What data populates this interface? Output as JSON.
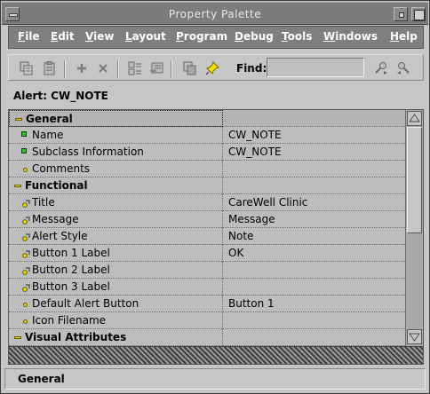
{
  "window": {
    "title": "Property Palette"
  },
  "menu": [
    {
      "label": "File",
      "u": "F",
      "rest": "ile"
    },
    {
      "label": "Edit",
      "u": "E",
      "rest": "dit"
    },
    {
      "label": "View",
      "u": "V",
      "rest": "iew"
    },
    {
      "label": "Layout",
      "u": "L",
      "rest": "ayout"
    },
    {
      "label": "Program",
      "u": "P",
      "rest": "rogram"
    },
    {
      "label": "Debug",
      "u": "D",
      "rest": "ebug"
    },
    {
      "label": "Tools",
      "u": "T",
      "rest": "ools"
    },
    {
      "label": "Windows",
      "u": "W",
      "rest": "indows"
    },
    {
      "label": "Help",
      "u": "H",
      "rest": "elp"
    }
  ],
  "toolbar": {
    "icons": [
      "copy-properties-icon",
      "paste-properties-icon",
      "add-property-icon",
      "delete-property-icon",
      "property-class-icon",
      "inherit-icon",
      "intersection-union-icon",
      "freeze-pin-icon",
      "find-forward-icon",
      "find-backward-icon"
    ],
    "find_label": "Find:",
    "find_value": ""
  },
  "alert": {
    "label": "Alert: CW_NOTE"
  },
  "properties": [
    {
      "type": "category",
      "name": "General",
      "value": "",
      "icon": "category-dash-icon"
    },
    {
      "type": "property",
      "name": "Name",
      "value": "CW_NOTE",
      "icon": "changed-property-icon"
    },
    {
      "type": "property",
      "name": "Subclass Information",
      "value": "CW_NOTE",
      "icon": "changed-property-icon"
    },
    {
      "type": "property",
      "name": "Comments",
      "value": "",
      "icon": "default-property-icon"
    },
    {
      "type": "category",
      "name": "Functional",
      "value": "",
      "icon": "category-dash-icon"
    },
    {
      "type": "property",
      "name": "Title",
      "value": "CareWell Clinic",
      "icon": "inherited-property-icon"
    },
    {
      "type": "property",
      "name": "Message",
      "value": "Message",
      "icon": "inherited-property-icon"
    },
    {
      "type": "property",
      "name": "Alert Style",
      "value": "Note",
      "icon": "inherited-property-icon"
    },
    {
      "type": "property",
      "name": "Button 1 Label",
      "value": "OK",
      "icon": "inherited-property-icon"
    },
    {
      "type": "property",
      "name": "Button 2 Label",
      "value": "",
      "icon": "inherited-property-icon"
    },
    {
      "type": "property",
      "name": "Button 3 Label",
      "value": "",
      "icon": "inherited-property-icon"
    },
    {
      "type": "property",
      "name": "Default Alert Button",
      "value": "Button 1",
      "icon": "default-property-icon"
    },
    {
      "type": "property",
      "name": "Icon Filename",
      "value": "",
      "icon": "default-property-icon"
    },
    {
      "type": "category",
      "name": "Visual Attributes",
      "value": "",
      "icon": "category-dash-icon"
    }
  ],
  "status": {
    "text": "General"
  },
  "colors": {
    "menubar": "#7f7f7f",
    "titlebar": "#7c7c7c",
    "window_bg": "#c6c6c6",
    "grid_bg": "#bdbdbd",
    "changed_icon": "#26c026",
    "category_icon": "#e6d200"
  }
}
